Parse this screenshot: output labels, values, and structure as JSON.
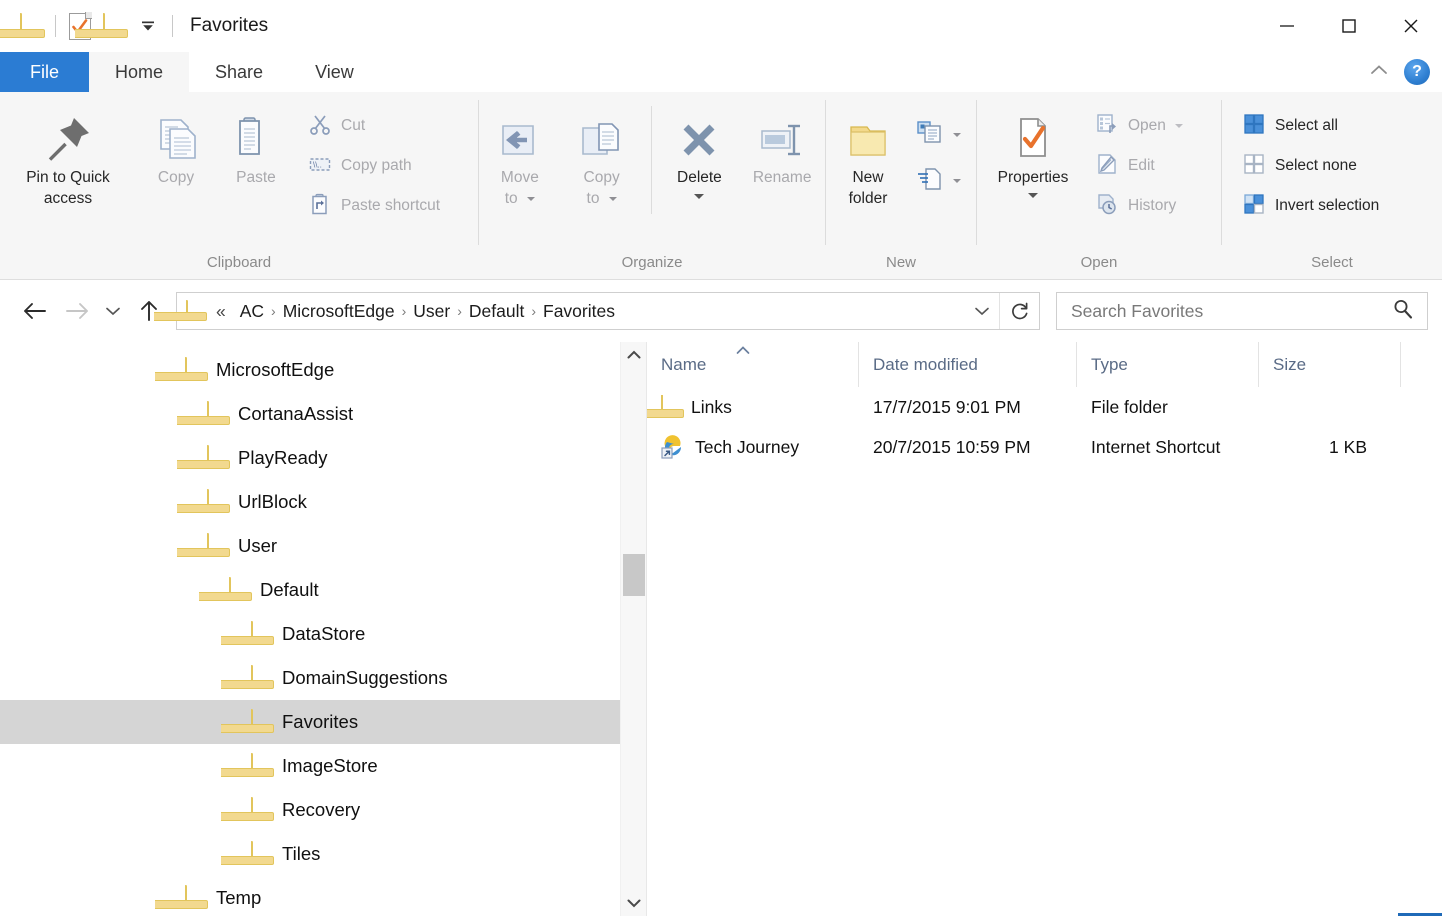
{
  "window": {
    "title": "Favorites",
    "quick_access": [
      {
        "name": "folder-icon",
        "label": "Folder"
      },
      {
        "name": "properties-icon",
        "label": "Properties"
      },
      {
        "name": "new-folder-icon",
        "label": "New folder"
      },
      {
        "name": "customize-dropdown-icon",
        "label": "Customize Quick Access Toolbar"
      }
    ],
    "controls": {
      "minimize": "—",
      "maximize": "□",
      "close": "✕"
    }
  },
  "tabs": [
    {
      "label": "File",
      "state": "file"
    },
    {
      "label": "Home",
      "state": "active"
    },
    {
      "label": "Share",
      "state": "normal"
    },
    {
      "label": "View",
      "state": "normal"
    }
  ],
  "ribbon": {
    "collapse_icon": "chevron-up-icon",
    "help_label": "?",
    "groups": [
      {
        "label": "Clipboard",
        "big": [
          {
            "label": "Pin to Quick\naccess",
            "line1": "Pin to Quick",
            "line2": "access",
            "icon": "pin-icon",
            "disabled": false
          },
          {
            "label": "Copy",
            "line1": "Copy",
            "line2": "",
            "icon": "copy-icon",
            "disabled": true
          },
          {
            "label": "Paste",
            "line1": "Paste",
            "line2": "",
            "icon": "paste-icon",
            "disabled": true
          }
        ],
        "small": [
          {
            "label": "Cut",
            "icon": "scissors-icon",
            "disabled": true
          },
          {
            "label": "Copy path",
            "icon": "copy-path-icon",
            "disabled": true
          },
          {
            "label": "Paste shortcut",
            "icon": "paste-shortcut-icon",
            "disabled": true
          }
        ]
      },
      {
        "label": "Organize",
        "big": [
          {
            "line1": "Move",
            "line2": "to",
            "icon": "move-to-icon",
            "disabled": true,
            "dropdown": true
          },
          {
            "line1": "Copy",
            "line2": "to",
            "icon": "copy-to-icon",
            "disabled": true,
            "dropdown": true
          },
          {
            "line1": "Delete",
            "line2": "",
            "icon": "delete-icon",
            "disabled": false,
            "split": true
          },
          {
            "line1": "Rename",
            "line2": "",
            "icon": "rename-icon",
            "disabled": true
          }
        ],
        "small": []
      },
      {
        "label": "New",
        "big": [
          {
            "line1": "New",
            "line2": "folder",
            "icon": "new-folder-icon",
            "disabled": false
          }
        ],
        "small": [
          {
            "label": "",
            "icon": "new-item-icon",
            "disabled": false,
            "dropdown": true
          },
          {
            "label": "",
            "icon": "easy-access-icon",
            "disabled": false,
            "dropdown": true
          }
        ]
      },
      {
        "label": "Open",
        "big": [
          {
            "line1": "Properties",
            "line2": "",
            "icon": "properties-icon",
            "disabled": false,
            "split": true
          }
        ],
        "small": [
          {
            "label": "Open",
            "icon": "open-icon",
            "disabled": true,
            "dropdown": true
          },
          {
            "label": "Edit",
            "icon": "edit-icon",
            "disabled": true
          },
          {
            "label": "History",
            "icon": "history-icon",
            "disabled": true
          }
        ]
      },
      {
        "label": "Select",
        "big": [],
        "small": [
          {
            "label": "Select all",
            "icon": "select-all-icon",
            "disabled": false
          },
          {
            "label": "Select none",
            "icon": "select-none-icon",
            "disabled": false
          },
          {
            "label": "Invert selection",
            "icon": "invert-selection-icon",
            "disabled": false
          }
        ]
      }
    ]
  },
  "address": {
    "back_icon": "arrow-left-icon",
    "forward_icon": "arrow-right-icon",
    "recent_icon": "chevron-down-icon",
    "up_icon": "arrow-up-icon",
    "back_enabled": true,
    "forward_enabled": false,
    "lead": "«",
    "crumbs": [
      "AC",
      "MicrosoftEdge",
      "User",
      "Default",
      "Favorites"
    ],
    "separator": "›",
    "dropdown_icon": "chevron-down-icon",
    "refresh_icon": "refresh-icon"
  },
  "search": {
    "placeholder": "Search Favorites",
    "icon": "search-icon"
  },
  "nav_tree": {
    "items": [
      {
        "label": "MicrosoftEdge",
        "depth": 0,
        "selected": false
      },
      {
        "label": "CortanaAssist",
        "depth": 1,
        "selected": false
      },
      {
        "label": "PlayReady",
        "depth": 1,
        "selected": false
      },
      {
        "label": "UrlBlock",
        "depth": 1,
        "selected": false
      },
      {
        "label": "User",
        "depth": 1,
        "selected": false
      },
      {
        "label": "Default",
        "depth": 2,
        "selected": false
      },
      {
        "label": "DataStore",
        "depth": 3,
        "selected": false
      },
      {
        "label": "DomainSuggestions",
        "depth": 3,
        "selected": false
      },
      {
        "label": "Favorites",
        "depth": 3,
        "selected": true
      },
      {
        "label": "ImageStore",
        "depth": 3,
        "selected": false
      },
      {
        "label": "Recovery",
        "depth": 3,
        "selected": false
      },
      {
        "label": "Tiles",
        "depth": 3,
        "selected": false
      },
      {
        "label": "Temp",
        "depth": 0,
        "selected": false
      }
    ],
    "scrollbar": {
      "up_icon": "chevron-up-icon",
      "down_icon": "chevron-down-icon"
    }
  },
  "file_list": {
    "columns": [
      {
        "label": "Name",
        "sorted": "asc",
        "sort_icon": "˄"
      },
      {
        "label": "Date modified",
        "sorted": "none"
      },
      {
        "label": "Type",
        "sorted": "none"
      },
      {
        "label": "Size",
        "sorted": "none"
      }
    ],
    "rows": [
      {
        "name": "Links",
        "date": "17/7/2015 9:01 PM",
        "type": "File folder",
        "size": "",
        "icon": "folder-icon"
      },
      {
        "name": "Tech Journey",
        "date": "20/7/2015 10:59 PM",
        "type": "Internet Shortcut",
        "size": "1 KB",
        "icon": "internet-shortcut-icon"
      }
    ]
  },
  "colors": {
    "accent": "#2b7cd3",
    "ribbon_bg": "#f6f6f6",
    "selection": "#d5d5d5",
    "folder_fill": "#f7e9ab",
    "folder_stroke": "#e2c55c",
    "header_text": "#5a6b86",
    "disabled_text": "#a9a9ad"
  }
}
